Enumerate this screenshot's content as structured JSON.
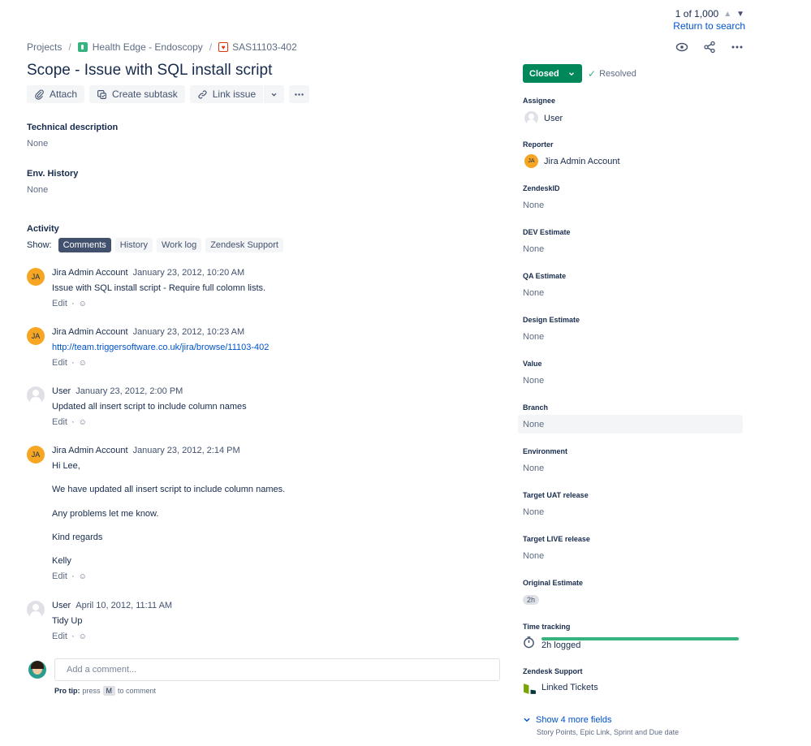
{
  "pager": {
    "position": "1 of 1,000",
    "return_label": "Return to search"
  },
  "breadcrumb": {
    "projects": "Projects",
    "project": "Health Edge - Endoscopy",
    "issue_key": "SAS11103-402"
  },
  "icons": {
    "watch": "eye-icon",
    "share": "share-icon",
    "more": "more-icon"
  },
  "title": "Scope - Issue with SQL install script",
  "toolbar": {
    "attach": "Attach",
    "create_subtask": "Create subtask",
    "link_issue": "Link issue"
  },
  "technical_description": {
    "label": "Technical description",
    "value": "None"
  },
  "env_history": {
    "label": "Env. History",
    "value": "None"
  },
  "activity": {
    "label": "Activity",
    "show_label": "Show:",
    "tabs": [
      "Comments",
      "History",
      "Work log",
      "Zendesk Support"
    ]
  },
  "comments": [
    {
      "author": "Jira Admin Account",
      "initials": "JA",
      "date": "January 23, 2012, 10:20 AM",
      "lines": [
        "Issue with SQL install script - Require full colomn lists."
      ],
      "edit": "Edit"
    },
    {
      "author": "Jira Admin Account",
      "initials": "JA",
      "date": "January 23, 2012, 10:23 AM",
      "link": "http://team.triggersoftware.co.uk/jira/browse/11103-402",
      "edit": "Edit"
    },
    {
      "author": "User",
      "date": "January 23, 2012, 2:00 PM",
      "lines": [
        "Updated all insert script to include column names"
      ],
      "edit": "Edit"
    },
    {
      "author": "Jira Admin Account",
      "initials": "JA",
      "date": "January 23, 2012, 2:14 PM",
      "lines": [
        "Hi Lee,",
        "We have updated all insert script to include column names.",
        "Any problems let me know.",
        "Kind regards",
        "Kelly"
      ],
      "edit": "Edit"
    },
    {
      "author": "User",
      "date": "April 10, 2012, 11:11 AM",
      "lines": [
        "Tidy Up"
      ],
      "edit": "Edit"
    }
  ],
  "add_comment": {
    "placeholder": "Add a comment...",
    "protip_prefix": "Pro tip:",
    "protip_press": "press",
    "protip_key": "M",
    "protip_suffix": "to comment"
  },
  "status": {
    "label": "Closed",
    "resolution": "Resolved",
    "color": "#00875a"
  },
  "fields": {
    "assignee": {
      "label": "Assignee",
      "value": "User"
    },
    "reporter": {
      "label": "Reporter",
      "value": "Jira Admin Account",
      "initials": "JA"
    },
    "zendesk_id": {
      "label": "ZendeskID",
      "value": "None"
    },
    "dev_estimate": {
      "label": "DEV Estimate",
      "value": "None"
    },
    "qa_estimate": {
      "label": "QA Estimate",
      "value": "None"
    },
    "design_estimate": {
      "label": "Design Estimate",
      "value": "None"
    },
    "value": {
      "label": "Value",
      "value": "None"
    },
    "branch": {
      "label": "Branch",
      "value": "None"
    },
    "environment": {
      "label": "Environment",
      "value": "None"
    },
    "target_uat": {
      "label": "Target UAT release",
      "value": "None"
    },
    "target_live": {
      "label": "Target LIVE release",
      "value": "None"
    },
    "original_estimate": {
      "label": "Original Estimate",
      "value": "2h"
    },
    "time_tracking": {
      "label": "Time tracking",
      "value": "2h logged",
      "progress": 1.0
    },
    "zendesk_support": {
      "label": "Zendesk Support",
      "value": "Linked Tickets"
    }
  },
  "more_fields": {
    "label": "Show 4 more fields",
    "sub": "Story Points, Epic Link, Sprint and Due date"
  }
}
